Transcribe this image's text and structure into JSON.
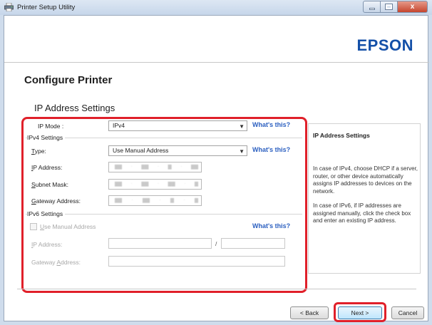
{
  "window": {
    "title": "Printer Setup Utility",
    "close_glyph": "x",
    "icons": [
      "printer-app-icon",
      "minimize-icon",
      "maximize-icon",
      "close-icon"
    ]
  },
  "brand": {
    "logo_text": "EPSON",
    "color": "#1450a8"
  },
  "page": {
    "title": "Configure Printer",
    "section_title": "IP Address Settings"
  },
  "ip_mode": {
    "label": "IP Mode :",
    "value": "IPv4",
    "help_link": "What's this?"
  },
  "ipv4": {
    "group_title": "IPv4 Settings",
    "type_label": "Type:",
    "type_value": "Use Manual Address",
    "type_help_link": "What's this?",
    "ip_address_label": "IP Address:",
    "subnet_mask_label": "Subnet Mask:",
    "gateway_label": "Gateway Address:"
  },
  "ipv6": {
    "group_title": "IPv6 Settings",
    "use_manual_label": "Use Manual Address",
    "use_manual_checked": false,
    "help_link": "What's this?",
    "ip_address_label": "IP Address:",
    "slash": "/",
    "gateway_label": "Gateway Address:"
  },
  "help_panel": {
    "title": "IP Address Settings",
    "paragraph1": "In case of IPv4, choose DHCP if a server, router, or other device automatically assigns IP addresses to devices on the network.",
    "paragraph2": "In case of IPv6, if IP addresses are assigned manually, click the check box and enter an existing IP address."
  },
  "buttons": {
    "back": "< Back",
    "next": "Next >",
    "cancel": "Cancel"
  },
  "colors": {
    "highlight": "#e0202a",
    "link": "#2b5fc0"
  }
}
